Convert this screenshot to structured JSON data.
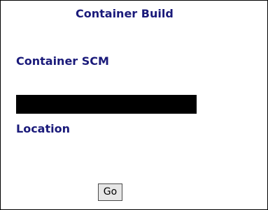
{
  "header": {
    "title": "Container Build"
  },
  "form": {
    "container_scm_label": "Container SCM",
    "container_scm_value": "",
    "location_label": "Location",
    "go_label": "Go"
  },
  "colors": {
    "label_text": "#1a1a7a",
    "field_fill": "#000000",
    "button_face": "#e6e6e6"
  }
}
